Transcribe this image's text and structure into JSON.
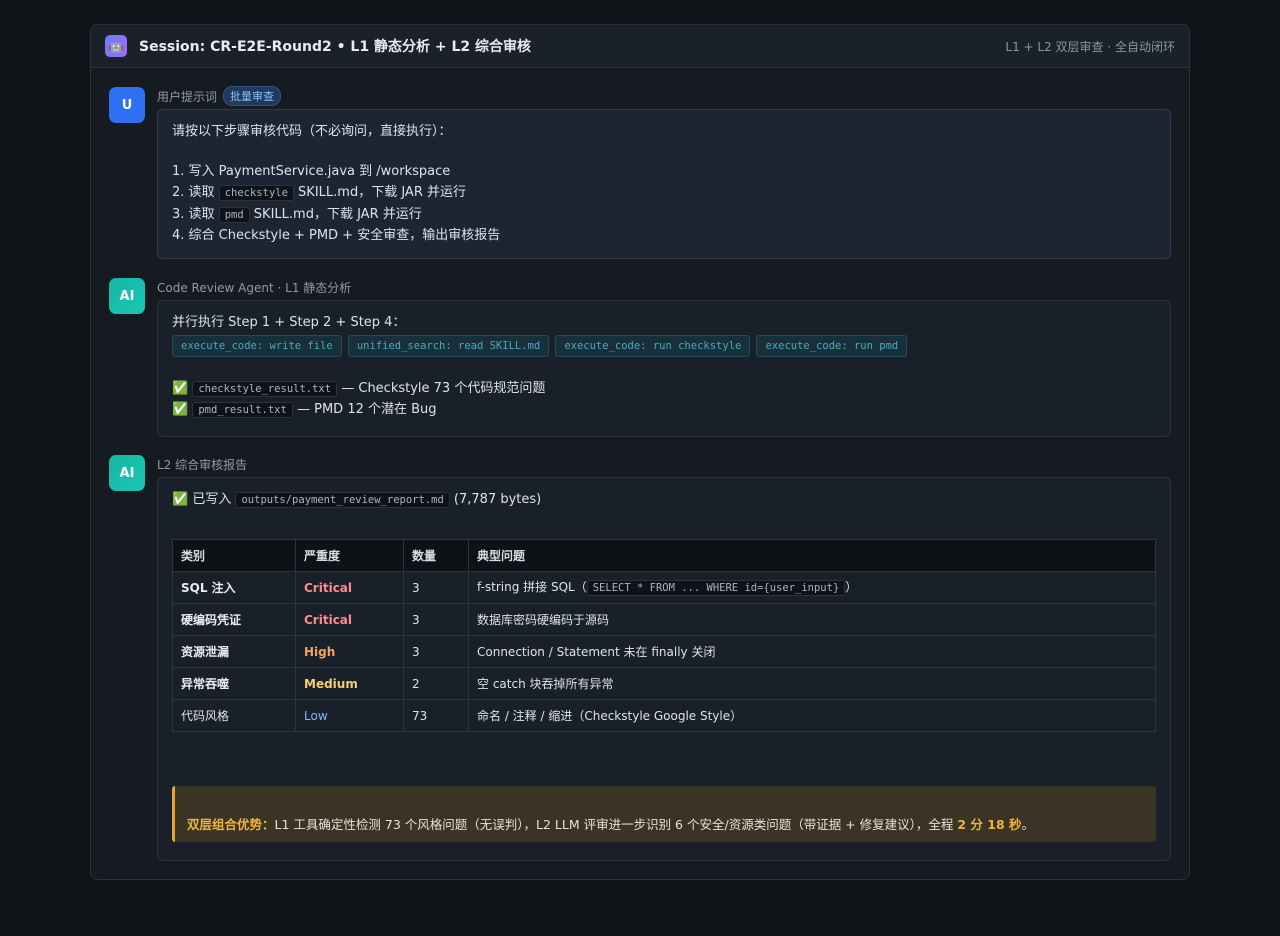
{
  "header": {
    "icon": "robot-icon",
    "title": "Session: CR-E2E-Round2 • L1 静态分析 + L2 综合审核",
    "subtitle": "L1 + L2 双层审查 · 全自动闭环"
  },
  "user_msg": {
    "avatar": "U",
    "label": "用户提示词",
    "tag": "批量审查",
    "intro": "请按以下步骤审核代码（不必询问，直接执行）：",
    "step1": "1. 写入 PaymentService.java 到 /workspace",
    "step2_pre": "2. 读取",
    "step2_code": "checkstyle",
    "step2_post": "SKILL.md，下载 JAR 并运行",
    "step3_pre": "3. 读取",
    "step3_code": "pmd",
    "step3_post": "SKILL.md，下载 JAR 并运行",
    "step4": "4. 综合 Checkstyle + PMD + 安全审查，输出审核报告"
  },
  "ai_msg1": {
    "avatar": "AI",
    "label": "Code Review Agent · L1 静态分析",
    "intro": "并行执行 Step 1 + Step 2 + Step 4：",
    "tools": [
      "execute_code: write file",
      "unified_search: read SKILL.md",
      "execute_code: run checkstyle",
      "execute_code: run pmd"
    ],
    "result1_file": "checkstyle_result.txt",
    "result1_text": "— Checkstyle 73 个代码规范问题",
    "result2_file": "pmd_result.txt",
    "result2_text": "— PMD 12 个潜在 Bug"
  },
  "ai_msg2": {
    "avatar": "AI",
    "label": "L2 综合审核报告",
    "written_pre": "已写入",
    "written_file": "outputs/payment_review_report.md",
    "written_size": "(7,787 bytes)",
    "table": {
      "headers": [
        "类别",
        "严重度",
        "数量",
        "典型问题"
      ],
      "rows": [
        {
          "category": "SQL 注入",
          "severity": "Critical",
          "count": "3",
          "issue_pre": "f-string 拼接 SQL（",
          "issue_code": "SELECT * FROM ... WHERE id={user_input}",
          "issue_post": "）"
        },
        {
          "category": "硬编码凭证",
          "severity": "Critical",
          "count": "3",
          "issue": "数据库密码硬编码于源码"
        },
        {
          "category": "资源泄漏",
          "severity": "High",
          "count": "3",
          "issue": "Connection / Statement 未在 finally 关闭"
        },
        {
          "category": "异常吞噬",
          "severity": "Medium",
          "count": "2",
          "issue": "空 catch 块吞掉所有异常"
        },
        {
          "category": "代码风格",
          "severity": "Low",
          "count": "73",
          "issue": "命名 / 注释 / 缩进（Checkstyle Google Style）"
        }
      ]
    },
    "note": {
      "lead": "双层组合优势：",
      "body": "L1 工具确定性检测 73 个风格问题（无误判），L2 LLM 评审进一步识别 6 个安全/资源类问题（带证据 + 修复建议），全程",
      "time": "2 分 18 秒",
      "end": "。"
    }
  },
  "check_mark": "✅"
}
